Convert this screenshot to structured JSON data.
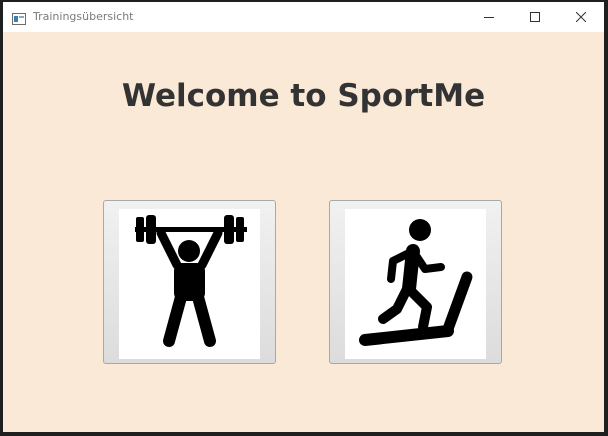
{
  "window": {
    "title": "Trainingsübersicht",
    "controls": [
      "minimize",
      "maximize",
      "close"
    ]
  },
  "main": {
    "heading": "Welcome to SportMe",
    "background_color": "#fae9d7",
    "buttons": [
      {
        "id": "weightlifting",
        "icon": "weightlifting-icon"
      },
      {
        "id": "treadmill",
        "icon": "treadmill-runner-icon"
      }
    ]
  }
}
